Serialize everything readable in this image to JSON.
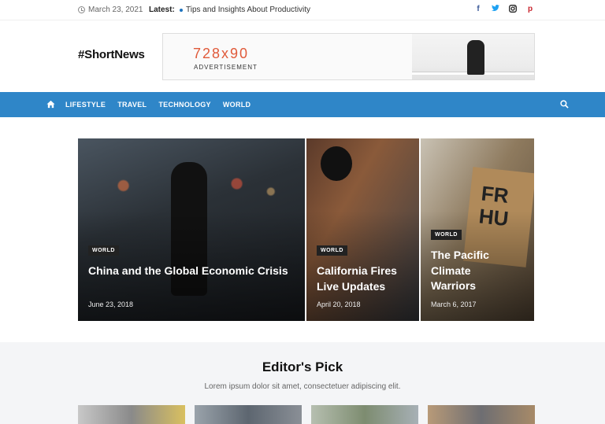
{
  "topbar": {
    "date": "March 23, 2021",
    "latest_label": "Latest:",
    "ticker": "Tips and Insights About Productivity",
    "social": [
      "facebook-icon",
      "twitter-icon",
      "instagram-icon",
      "pinterest-icon"
    ]
  },
  "header": {
    "logo": "#ShortNews",
    "ad_size": "728x90",
    "ad_label": "ADVERTISEMENT"
  },
  "nav": {
    "items": [
      "LIFESTYLE",
      "TRAVEL",
      "TECHNOLOGY",
      "WORLD"
    ],
    "color": "#2f86c8"
  },
  "hero": [
    {
      "category": "WORLD",
      "title": "China and the Global Economic Crisis",
      "date": "June 23, 2018"
    },
    {
      "category": "WORLD",
      "title": "California Fires Live Updates",
      "date": "April 20, 2018"
    },
    {
      "category": "WORLD",
      "title": "The Pacific Climate Warriors",
      "date": "March 6, 2017"
    }
  ],
  "hero_sign_text": "FR HU",
  "editors_pick": {
    "title": "Editor's Pick",
    "subtitle": "Lorem ipsum dolor sit amet, consectetuer adipiscing elit."
  }
}
